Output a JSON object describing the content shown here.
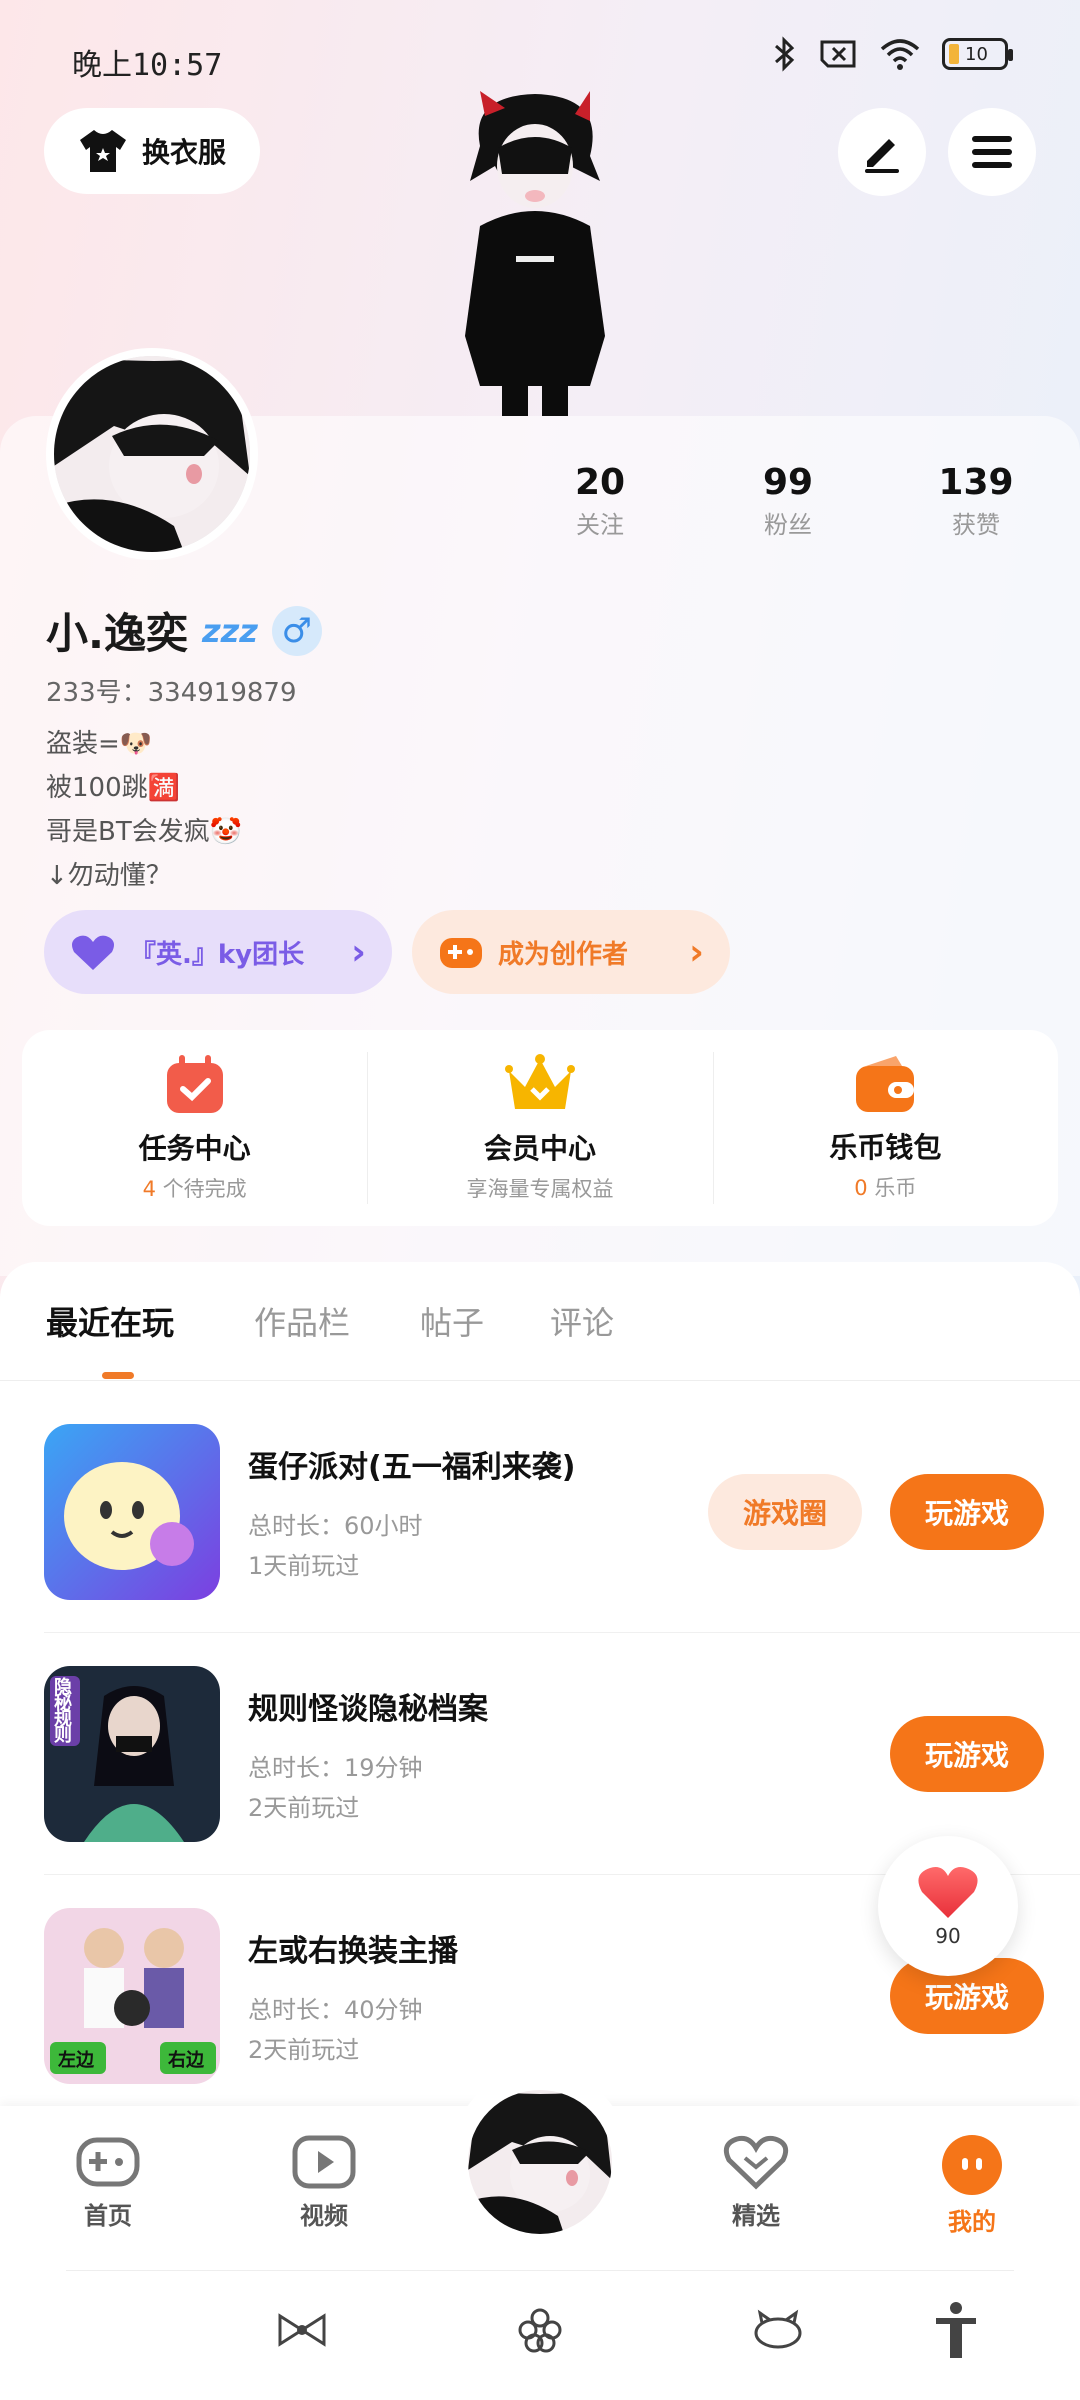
{
  "status_bar": {
    "time": "晚上10:57",
    "battery": "10"
  },
  "top": {
    "dressup_label": "换衣服"
  },
  "profile": {
    "username": "小.逸奕",
    "zzz": "zzz",
    "gender": "♂",
    "uid": "233号：334919879",
    "bio": [
      "盗装=🐶",
      "被100跳🈵",
      "哥是BT会发疯🤡",
      "↓勿动懂？"
    ],
    "stats": [
      {
        "num": "20",
        "label": "关注"
      },
      {
        "num": "99",
        "label": "粉丝"
      },
      {
        "num": "139",
        "label": "获赞"
      }
    ],
    "group_pill": "『英.』ky团长",
    "creator_pill": "成为创作者",
    "chevron": "›"
  },
  "features": [
    {
      "title": "任务中心",
      "sub_highlight": "4",
      "sub_text": "个待完成"
    },
    {
      "title": "会员中心",
      "sub_highlight": "",
      "sub_text": "享海量专属权益"
    },
    {
      "title": "乐币钱包",
      "sub_highlight": "0",
      "sub_text": "乐币"
    }
  ],
  "tabs": [
    "最近在玩",
    "作品栏",
    "帖子",
    "评论"
  ],
  "games": [
    {
      "title": "蛋仔派对(五一福利来袭)",
      "duration": "总时长：60小时",
      "last": "1天前玩过",
      "circle": "游戏圈",
      "play": "玩游戏"
    },
    {
      "title": "规则怪谈隐秘档案",
      "duration": "总时长：19分钟",
      "last": "2天前玩过",
      "play": "玩游戏"
    },
    {
      "title": "左或右换装主播",
      "duration": "总时长：40分钟",
      "last": "2天前玩过",
      "play": "玩游戏"
    }
  ],
  "thumb_text": {
    "game2": "隐秘规则",
    "game3_left": "左边",
    "game3_right": "右边"
  },
  "like_float": {
    "count": "90"
  },
  "nav": [
    "首页",
    "视频",
    "精选",
    "我的"
  ],
  "colors": {
    "accent": "#f57518",
    "purple": "#7a5ce6"
  }
}
